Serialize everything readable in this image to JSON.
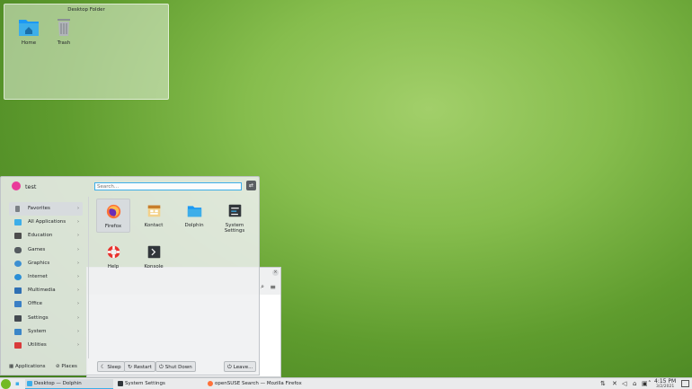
{
  "desktop_folder": {
    "title": "Desktop Folder",
    "items": [
      {
        "label": "Home",
        "icon": "home-folder-icon"
      },
      {
        "label": "Trash",
        "icon": "trash-icon"
      }
    ]
  },
  "launcher": {
    "user_name": "test",
    "search_placeholder": "Search...",
    "categories": [
      {
        "label": "Favorites",
        "icon": "bookmark-icon",
        "color": "#7c8186"
      },
      {
        "label": "All Applications",
        "icon": "grid-icon",
        "color": "#3daee9"
      },
      {
        "label": "Education",
        "icon": "education-icon",
        "color": "#4d4d4d"
      },
      {
        "label": "Games",
        "icon": "gamepad-icon",
        "color": "#555b60"
      },
      {
        "label": "Graphics",
        "icon": "graphics-icon",
        "color": "#3d8fd1"
      },
      {
        "label": "Internet",
        "icon": "globe-icon",
        "color": "#2b8fd6"
      },
      {
        "label": "Multimedia",
        "icon": "multimedia-icon",
        "color": "#2f6fb3"
      },
      {
        "label": "Office",
        "icon": "office-icon",
        "color": "#3a7fc5"
      },
      {
        "label": "Settings",
        "icon": "settings-icon",
        "color": "#444a50"
      },
      {
        "label": "System",
        "icon": "system-icon",
        "color": "#3b86c8"
      },
      {
        "label": "Utilities",
        "icon": "toolbox-icon",
        "color": "#d93b3b"
      }
    ],
    "favorites": [
      {
        "label": "Firefox",
        "icon": "firefox-icon"
      },
      {
        "label": "Kontact",
        "icon": "kontact-icon"
      },
      {
        "label": "Dolphin",
        "icon": "dolphin-icon"
      },
      {
        "label": "System Settings",
        "icon": "system-settings-icon"
      },
      {
        "label": "Help",
        "icon": "help-lifebuoy-icon"
      },
      {
        "label": "Konsole",
        "icon": "konsole-icon"
      }
    ],
    "footer": {
      "applications_tab": "Applications",
      "places_tab": "Places",
      "sleep": "Sleep",
      "restart": "Restart",
      "shut_down": "Shut Down",
      "leave": "Leave..."
    }
  },
  "taskbar": {
    "tasks": [
      {
        "label": "Desktop — Dolphin",
        "icon": "dolphin-icon"
      },
      {
        "label": "System Settings",
        "icon": "system-settings-icon"
      },
      {
        "label": "openSUSE Search — Mozilla Firefox",
        "icon": "firefox-icon"
      }
    ],
    "clock_time": "4:15 PM",
    "clock_date": "3/2/2021"
  },
  "colors": {
    "accent": "#3daee9",
    "opensuse_green": "#73ba25",
    "avatar": "#e93a9a"
  }
}
